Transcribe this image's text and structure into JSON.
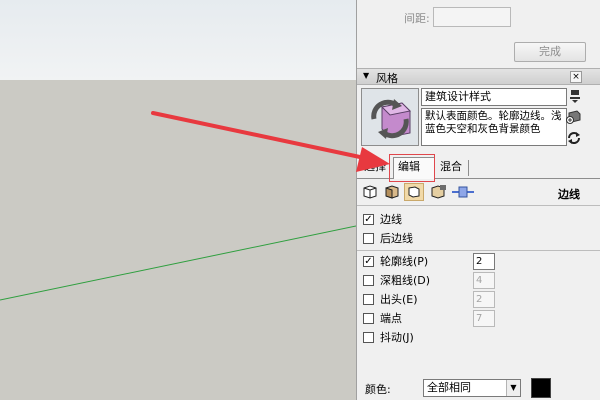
{
  "panel": {
    "top": {
      "spacing_label": "间距:",
      "spacing_value": "",
      "done_button": "完成"
    },
    "style_tray": {
      "title": "风格",
      "close_symbol": "×",
      "style_name": "建筑设计样式",
      "style_description": "默认表面颜色。轮廓边线。浅蓝色天空和灰色背景颜色",
      "tabs": [
        {
          "label": "选择",
          "active": false
        },
        {
          "label": "编辑",
          "active": true
        },
        {
          "label": "混合",
          "active": false
        }
      ],
      "section_title": "边线",
      "edge_settings": [
        {
          "label": "边线",
          "checked": true
        },
        {
          "label": "后边线",
          "checked": false
        },
        {
          "label": "轮廓线(P)",
          "checked": true,
          "value": "2",
          "value_enabled": true
        },
        {
          "label": "深粗线(D)",
          "checked": false,
          "value": "4",
          "value_enabled": false
        },
        {
          "label": "出头(E)",
          "checked": false,
          "value": "2",
          "value_enabled": false
        },
        {
          "label": "端点",
          "checked": false,
          "value": "7",
          "value_enabled": false
        },
        {
          "label": "抖动(J)",
          "checked": false
        }
      ],
      "color_label": "颜色:",
      "color_mode": "全部相同",
      "color_value": "#000000"
    }
  },
  "viewport": {
    "sky_color": "#e9edf0",
    "ground_color": "#cbcac4",
    "axis_color": "#2f9f3f"
  },
  "annotation": {
    "arrow_color": "#e8393f"
  },
  "icons": {
    "style_refresh": "refresh-icon",
    "mode_icons": [
      "edge-settings-icon",
      "face-settings-icon",
      "background-settings-icon",
      "watermark-settings-icon",
      "modeling-settings-icon"
    ]
  }
}
